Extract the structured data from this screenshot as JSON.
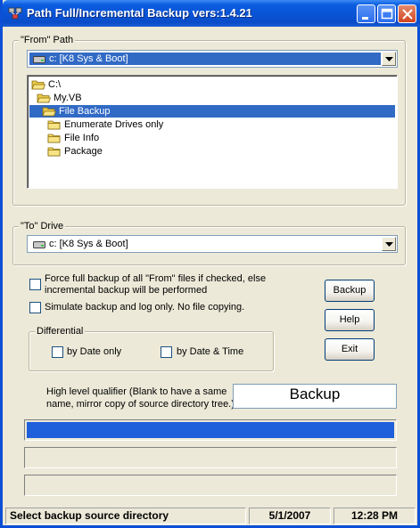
{
  "window": {
    "title": "Path Full/Incremental Backup vers:1.4.21",
    "icons": {
      "app": "backup-app-icon",
      "minimize": "minimize-icon",
      "maximize": "maximize-icon",
      "close": "close-icon"
    }
  },
  "from_group": {
    "label": "\"From\" Path",
    "drive_combo": {
      "value": "c: [K8 Sys & Boot]",
      "icon": "drive-icon"
    },
    "tree": [
      {
        "label": "C:\\",
        "level": 0,
        "icon": "open-folder-icon",
        "selected": false
      },
      {
        "label": "My.VB",
        "level": 1,
        "icon": "open-folder-icon",
        "selected": false
      },
      {
        "label": "File Backup",
        "level": 2,
        "icon": "open-folder-icon",
        "selected": true
      },
      {
        "label": "Enumerate Drives only",
        "level": 3,
        "icon": "folder-icon",
        "selected": false
      },
      {
        "label": "File Info",
        "level": 3,
        "icon": "folder-icon",
        "selected": false
      },
      {
        "label": "Package",
        "level": 3,
        "icon": "folder-icon",
        "selected": false
      }
    ]
  },
  "to_group": {
    "label": "\"To\" Drive",
    "drive_combo": {
      "value": "c: [K8 Sys & Boot]",
      "icon": "drive-icon"
    }
  },
  "options": {
    "force_full": {
      "line1": "Force full backup of all \"From\" files if checked, else",
      "line2": "incremental backup will be performed",
      "checked": false
    },
    "simulate": {
      "label": "Simulate backup and log only.  No file copying.",
      "checked": false
    }
  },
  "differential": {
    "label": "Differential",
    "by_date": {
      "label": "by Date only",
      "checked": false
    },
    "by_date_time": {
      "label": "by Date & Time",
      "checked": false
    }
  },
  "buttons": {
    "backup": "Backup",
    "help": "Help",
    "exit": "Exit"
  },
  "qualifier": {
    "line1": "High level qualifier (Blank to have a same",
    "line2": "name, mirror copy of source directory tree.)",
    "value": "Backup"
  },
  "progress_bars": [
    1.0,
    0.0,
    0.0
  ],
  "status": {
    "message": "Select backup source directory",
    "date": "5/1/2007",
    "time": "12:28 PM"
  },
  "colors": {
    "title_blue": "#0a5ce0",
    "selection": "#316ac5",
    "progress": "#1e5fdc",
    "face": "#ece9d8"
  }
}
